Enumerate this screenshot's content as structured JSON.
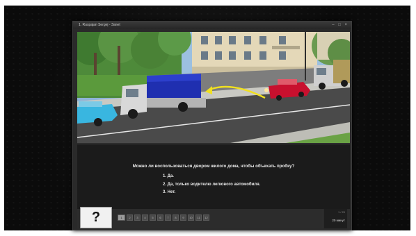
{
  "window": {
    "title": "1. Ruspajan Sergej - Заnet"
  },
  "scene": {
    "alt": ""
  },
  "question": {
    "text": "Можно ли воспользоваться двором жилого дома, чтобы объехать пробку?",
    "answers": [
      {
        "label": "1. Да."
      },
      {
        "label": "2. Да, только водителю легкового автомобиля."
      },
      {
        "label": "3. Нет."
      }
    ]
  },
  "bottom": {
    "help_symbol": "?",
    "question_numbers": [
      "1",
      "2",
      "3",
      "4",
      "5",
      "6",
      "7",
      "8",
      "9",
      "10",
      "11",
      "12"
    ],
    "progress_text": "1 / 20",
    "timer_text": "20 минут"
  },
  "colors": {
    "bus_tarp": "#1f2fb0",
    "car_red": "#c8102e",
    "car_blue": "#39b6e0",
    "arrow": "#f0e020"
  }
}
